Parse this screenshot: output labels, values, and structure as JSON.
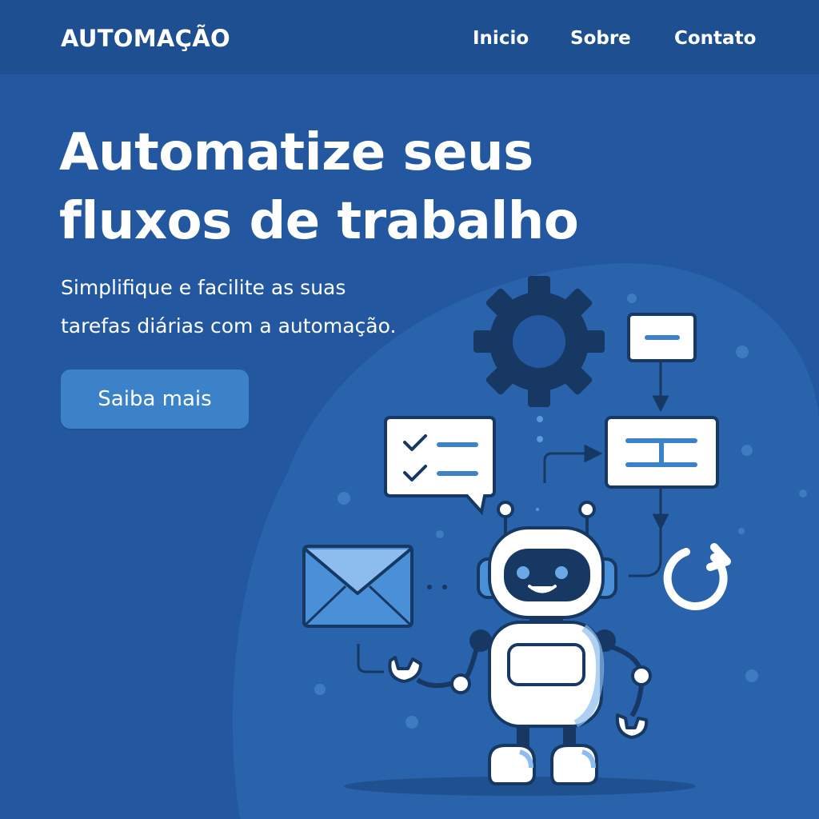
{
  "nav": {
    "brand": "AUTOMAÇÃO",
    "links": [
      "Inicio",
      "Sobre",
      "Contato"
    ]
  },
  "hero": {
    "title_lines": [
      "Automatize seus",
      "fluxos de trabalho"
    ],
    "subtitle_lines": [
      "Simplifique e facilite as suas",
      "tarefas diárias com a automação."
    ],
    "cta_label": "Saiba mais"
  },
  "colors": {
    "background": "#2358a0",
    "navbar": "#1e4f90",
    "accent": "#3b82c8",
    "dark_navy": "#163862",
    "light_blue": "#4a90d9"
  },
  "icons": [
    "gear-icon",
    "checklist-chat-icon",
    "flow-node-icon",
    "envelope-icon",
    "refresh-icon",
    "robot-mascot"
  ]
}
